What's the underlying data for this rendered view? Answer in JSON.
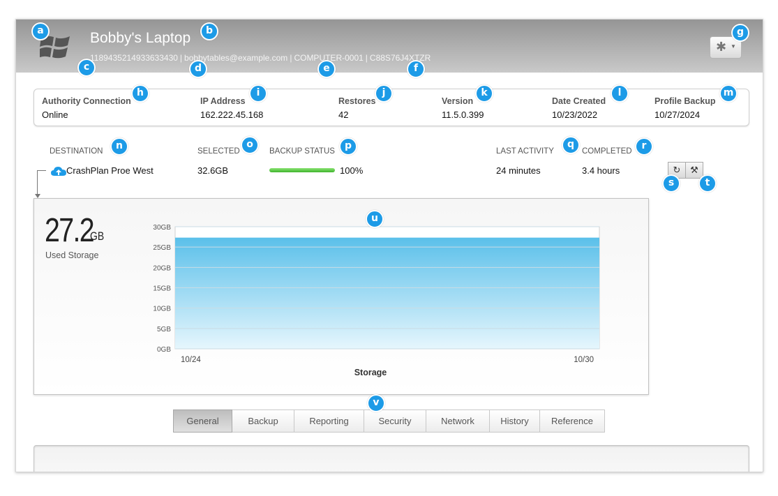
{
  "device": {
    "name": "Bobby's Laptop",
    "guid": "1189435214933633430",
    "email": "bobbytables@example.com",
    "computer": "COMPUTER-0001",
    "code": "C88S76J4XTZR",
    "meta_separator": "|"
  },
  "stats": [
    {
      "label": "Authority Connection",
      "value": "Online"
    },
    {
      "label": "IP Address",
      "value": "162.222.45.168"
    },
    {
      "label": "Restores",
      "value": "42"
    },
    {
      "label": "Version",
      "value": "11.5.0.399"
    },
    {
      "label": "Date Created",
      "value": "10/23/2022"
    },
    {
      "label": "Profile Backup",
      "value": "10/27/2024"
    }
  ],
  "destination_table": {
    "headers": {
      "destination": "DESTINATION",
      "selected": "SELECTED",
      "backup_status": "BACKUP STATUS",
      "last_activity": "LAST ACTIVITY",
      "completed": "COMPLETED"
    },
    "row": {
      "destination": "CrashPlan Proe West",
      "selected": "32.6GB",
      "backup_percent_label": "100%",
      "backup_percent": 100,
      "last_activity": "24 minutes",
      "completed": "3.4 hours"
    }
  },
  "storage": {
    "used_value": "27.2",
    "used_unit": "GB",
    "used_label": "Used Storage"
  },
  "chart_data": {
    "type": "area",
    "title": "",
    "xlabel": "Storage",
    "ylabel": "",
    "x_ticks": [
      "10/24",
      "10/30"
    ],
    "y_ticks": [
      "0GB",
      "5GB",
      "10GB",
      "15GB",
      "20GB",
      "25GB",
      "30GB"
    ],
    "ylim": [
      0,
      30
    ],
    "grid": true,
    "series": [
      {
        "values": [
          27.2,
          27.2
        ]
      }
    ],
    "color": "#5bc0ea"
  },
  "tabs": [
    {
      "label": "General",
      "active": true
    },
    {
      "label": "Backup",
      "active": false
    },
    {
      "label": "Reporting",
      "active": false
    },
    {
      "label": "Security",
      "active": false
    },
    {
      "label": "Network",
      "active": false
    },
    {
      "label": "History",
      "active": false
    },
    {
      "label": "Reference",
      "active": false
    }
  ],
  "icons": {
    "os": "windows-logo-icon",
    "settings": "gear-icon",
    "destination": "cloud-upload-icon",
    "replace": "refresh-icon",
    "tools": "wrench-icon"
  },
  "annotations": [
    "a",
    "b",
    "c",
    "d",
    "e",
    "f",
    "g",
    "h",
    "i",
    "j",
    "k",
    "l",
    "m",
    "n",
    "o",
    "p",
    "q",
    "r",
    "s",
    "t",
    "u",
    "v"
  ],
  "colors": {
    "badge": "#1d9be7",
    "chart_fill": "#5bc0ea",
    "progress": "#4cc437"
  }
}
